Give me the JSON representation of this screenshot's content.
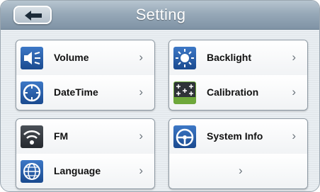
{
  "header": {
    "title": "Setting",
    "back_icon": "back-arrow-icon"
  },
  "groups": [
    {
      "items": [
        {
          "label": "Volume",
          "icon": "speaker-icon",
          "chevron": "›"
        },
        {
          "label": "DateTime",
          "icon": "clock-icon",
          "chevron": "›"
        }
      ]
    },
    {
      "items": [
        {
          "label": "Backlight",
          "icon": "sun-icon",
          "chevron": "›"
        },
        {
          "label": "Calibration",
          "icon": "crosshair-target-icon",
          "chevron": "›"
        }
      ]
    },
    {
      "items": [
        {
          "label": "FM",
          "icon": "radio-wave-icon",
          "chevron": "›"
        },
        {
          "label": "Language",
          "icon": "globe-icon",
          "chevron": "›"
        }
      ]
    },
    {
      "items": [
        {
          "label": "System Info",
          "icon": "steering-wheel-icon",
          "chevron": "›"
        },
        {
          "label": "",
          "icon": "",
          "chevron": "›"
        }
      ]
    }
  ],
  "colors": {
    "header_top": "#b7c5d0",
    "header_bottom": "#7f93a5",
    "background": "#e9eef2",
    "icon_blue": "#1f4f96",
    "icon_dark": "#3a3f45",
    "calibration_green": "#6ea83b"
  }
}
